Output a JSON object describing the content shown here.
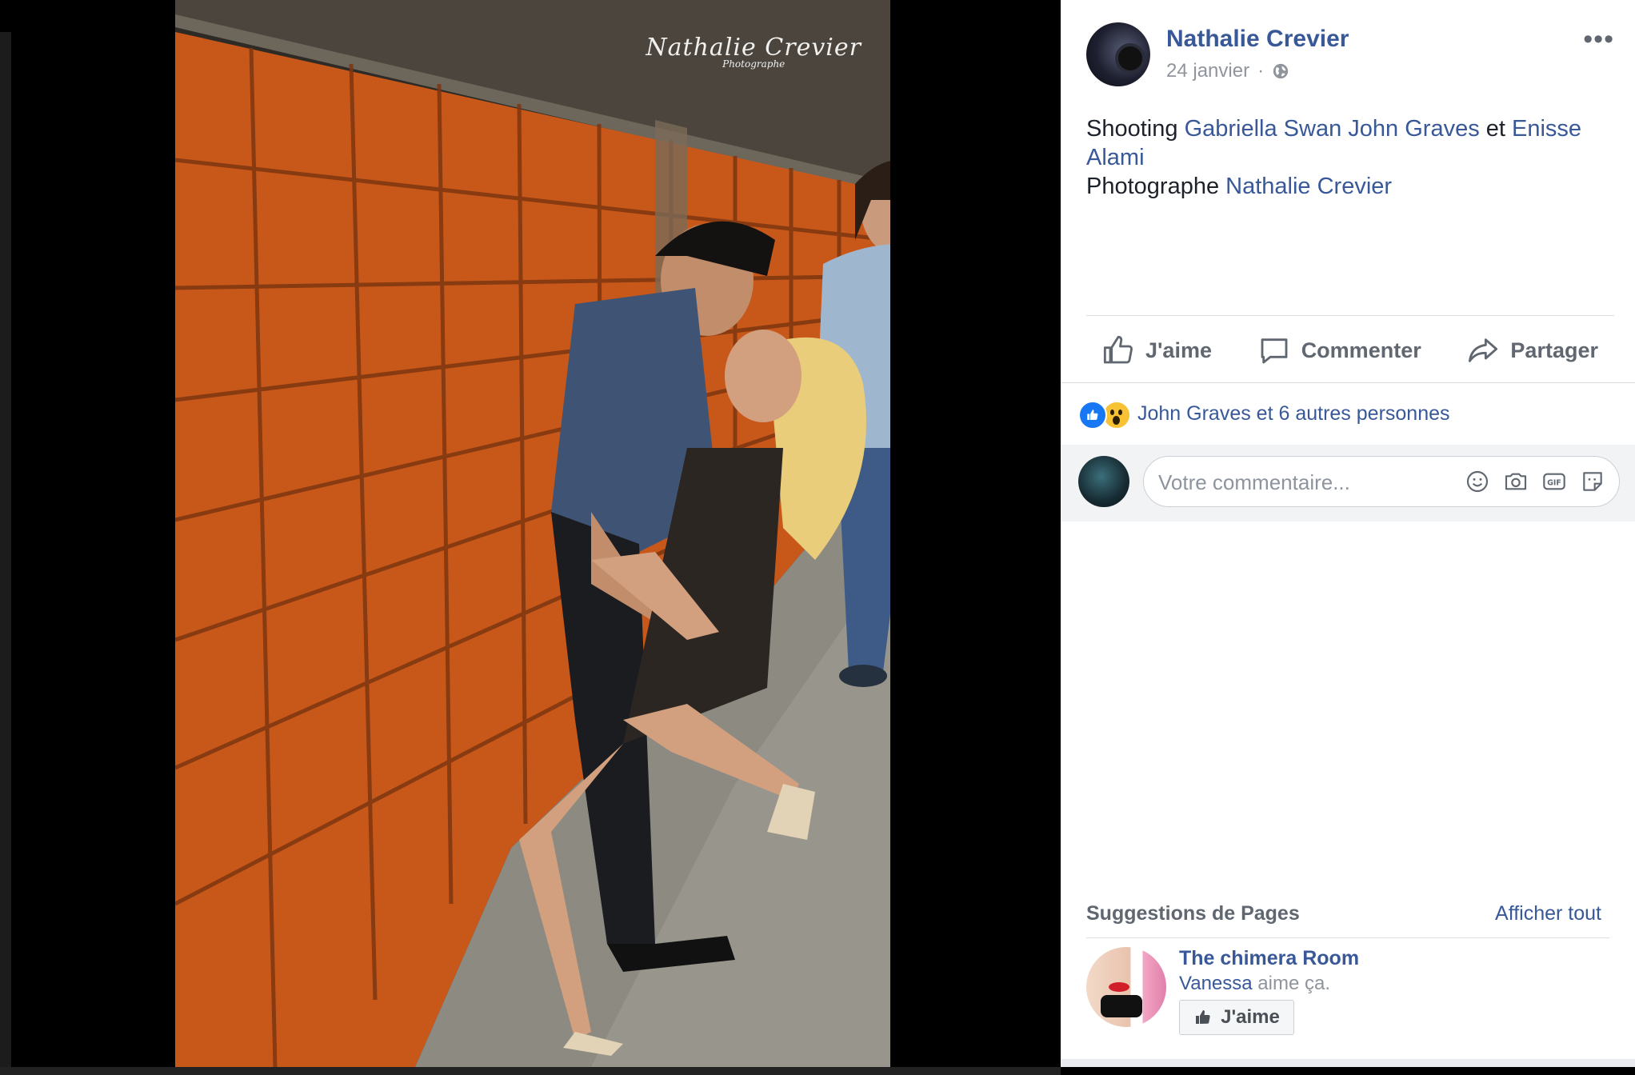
{
  "post": {
    "author": "Nathalie Crevier",
    "date": "24 janvier",
    "date_separator": "·",
    "caption": {
      "shooting": "Shooting",
      "tag1": "Gabriella Swan",
      "tag2": "John Graves",
      "et": "et",
      "tag3": "Enisse Alami",
      "photographe": "Photographe",
      "tag4": "Nathalie Crevier"
    },
    "more_label": "•••"
  },
  "photo": {
    "watermark_signature": "Nathalie Crevier",
    "watermark_sub": "Photographe"
  },
  "actions": {
    "like": "J'aime",
    "comment": "Commenter",
    "share": "Partager"
  },
  "reactions": {
    "summary": "John Graves et 6 autres personnes",
    "icons": [
      "like-icon",
      "wow-icon"
    ]
  },
  "comment_box": {
    "placeholder": "Votre commentaire...",
    "tools": [
      "emoji-icon",
      "camera-icon",
      "gif-icon",
      "sticker-icon"
    ]
  },
  "suggestions": {
    "title": "Suggestions de Pages",
    "see_all": "Afficher tout",
    "page": {
      "name": "The chimera Room",
      "liker": "Vanessa",
      "liker_suffix": "aime ça.",
      "like_button": "J'aime"
    }
  },
  "colors": {
    "link": "#385898",
    "secondary_text": "#90949c",
    "like_blue": "#1877f2",
    "tile_orange": "#d8641e"
  }
}
